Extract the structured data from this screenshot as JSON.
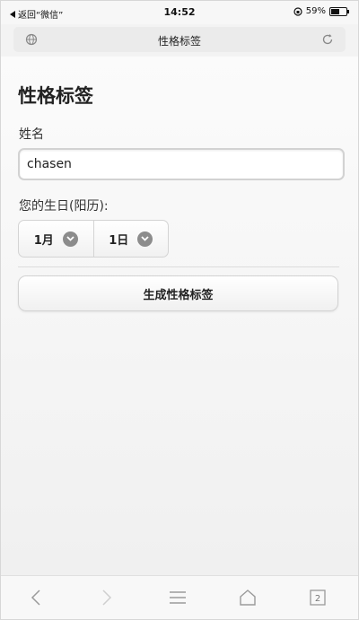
{
  "status_bar": {
    "back_label": "返回“微信”",
    "time": "14:52",
    "battery_text": "59%",
    "battery_level": 0.59
  },
  "address_bar": {
    "title": "性格标签"
  },
  "form": {
    "title": "性格标签",
    "name_label": "姓名",
    "name_value": "chasen",
    "birthday_label": "您的生日(阳历):",
    "month_value": "1月",
    "day_value": "1日",
    "submit_label": "生成性格标签"
  },
  "toolbar": {
    "tabs_count": "2"
  },
  "icons": {
    "status_back": "back-triangle-icon",
    "status_lock": "rotation-lock-icon",
    "status_battery": "battery-icon",
    "address_left": "globe-icon",
    "address_right": "reload-icon",
    "select_chevron": "chevron-down-icon",
    "toolbar_back": "chevron-left-icon",
    "toolbar_forward": "chevron-right-icon",
    "toolbar_menu": "menu-icon",
    "toolbar_home": "home-icon",
    "toolbar_tabs": "tabs-icon"
  },
  "colors": {
    "page_bg": "#f3f3f3",
    "chevron_bg": "#8c8c8c",
    "border": "#d2d2d2"
  }
}
